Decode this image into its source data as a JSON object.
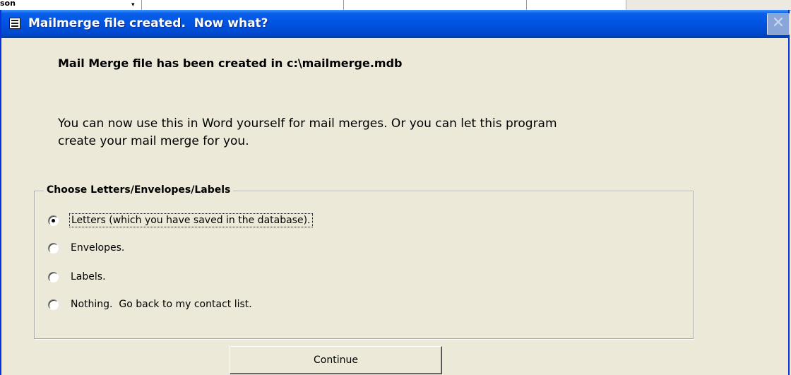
{
  "background_app": {
    "visible_fragment": "son"
  },
  "dialog": {
    "title": "Mailmerge file created.  Now what?",
    "close_symbol": "✕",
    "heading": "Mail Merge file has been created in c:\\mailmerge.mdb",
    "body_line1": "You can now use this in Word yourself for mail merges.  Or you can let this program",
    "body_line2": "create your mail merge for you.",
    "group_title": "Choose Letters/Envelopes/Labels",
    "options": [
      {
        "label": "Letters (which you have saved in the database).",
        "checked": true
      },
      {
        "label": "Envelopes.",
        "checked": false
      },
      {
        "label": "Labels.",
        "checked": false
      },
      {
        "label": "Nothing.  Go back to my contact list.",
        "checked": false
      }
    ],
    "continue_label": "Continue"
  },
  "colors": {
    "titlebar": "#0054e3",
    "dialog_bg": "#ece9d8"
  }
}
